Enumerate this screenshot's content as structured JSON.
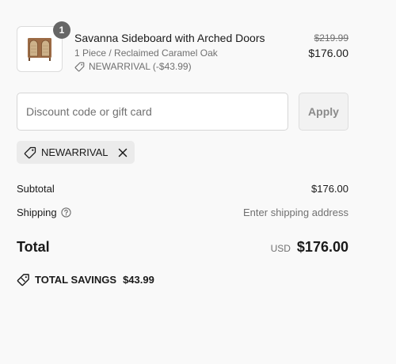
{
  "line_item": {
    "quantity": "1",
    "title": "Savanna Sideboard with Arched Doors",
    "variant": "1 Piece / Reclaimed Caramel Oak",
    "discount": "NEWARRIVAL (-$43.99)",
    "original_price": "$219.99",
    "final_price": "$176.00",
    "discount_icon": "tag-icon"
  },
  "discount_form": {
    "placeholder": "Discount code or gift card",
    "value": "",
    "apply_label": "Apply"
  },
  "applied_code": {
    "code": "NEWARRIVAL",
    "icon": "tag-icon",
    "remove_icon": "close-icon"
  },
  "summary": {
    "subtotal_label": "Subtotal",
    "subtotal_value": "$176.00",
    "shipping_label": "Shipping",
    "shipping_value": "Enter shipping address",
    "shipping_help_icon": "question-circle-icon",
    "total_label": "Total",
    "total_currency": "USD",
    "total_value": "$176.00"
  },
  "savings": {
    "label": "TOTAL SAVINGS",
    "value": "$43.99",
    "icon": "tag-icon"
  },
  "colors": {
    "background": "#f9f9f9",
    "text": "#1a1a1a",
    "muted_text": "#707070",
    "badge": "#666666",
    "chip": "#ebebeb"
  }
}
